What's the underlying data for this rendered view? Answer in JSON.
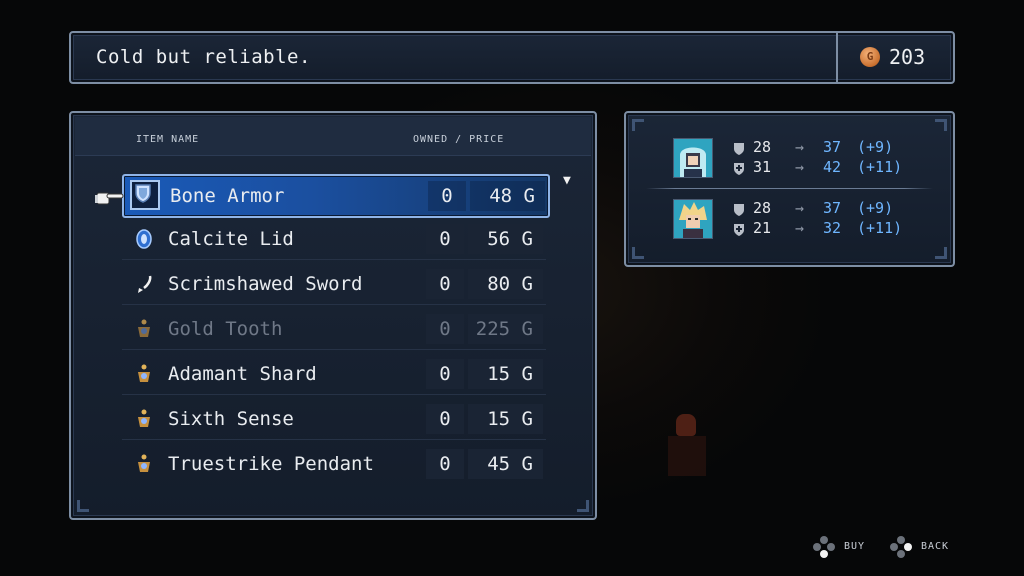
{
  "description": "Cold but reliable.",
  "gold": {
    "icon": "gold-coin-icon",
    "coin_letter": "G",
    "amount": "203"
  },
  "list": {
    "header_name": "Item name",
    "header_owned_price": "Owned / Price",
    "items": [
      {
        "icon": "armor-icon",
        "name": "Bone Armor",
        "owned": "0",
        "price": "48 G",
        "selected": true
      },
      {
        "icon": "shield-icon",
        "name": "Calcite Lid",
        "owned": "0",
        "price": "56 G"
      },
      {
        "icon": "sword-icon",
        "name": "Scrimshawed Sword",
        "owned": "0",
        "price": "80 G"
      },
      {
        "icon": "trinket-icon",
        "name": "Gold Tooth",
        "owned": "0",
        "price": "225 G",
        "dimmed": true
      },
      {
        "icon": "trinket-icon",
        "name": "Adamant Shard",
        "owned": "0",
        "price": "15 G"
      },
      {
        "icon": "trinket-icon",
        "name": "Sixth Sense",
        "owned": "0",
        "price": "15 G"
      },
      {
        "icon": "trinket-icon",
        "name": "Truestrike Pendant",
        "owned": "0",
        "price": "45 G"
      }
    ]
  },
  "stats": {
    "characters": [
      {
        "portrait": "teal-hair-portrait",
        "lines": [
          {
            "icon": "physical-defense-icon",
            "current": "28",
            "arrow": "→",
            "new": "37",
            "diff": "(+9)"
          },
          {
            "icon": "magic-defense-icon",
            "current": "31",
            "arrow": "→",
            "new": "42",
            "diff": "(+11)"
          }
        ]
      },
      {
        "portrait": "blonde-hair-portrait",
        "lines": [
          {
            "icon": "physical-defense-icon",
            "current": "28",
            "arrow": "→",
            "new": "37",
            "diff": "(+9)"
          },
          {
            "icon": "magic-defense-icon",
            "current": "21",
            "arrow": "→",
            "new": "32",
            "diff": "(+11)"
          }
        ]
      }
    ]
  },
  "hints": {
    "buy": "Buy",
    "back": "Back"
  },
  "colors": {
    "highlight": "#1a5ab8",
    "stat_up": "#6fb6ff",
    "panel_border": "#7d8ea4"
  }
}
